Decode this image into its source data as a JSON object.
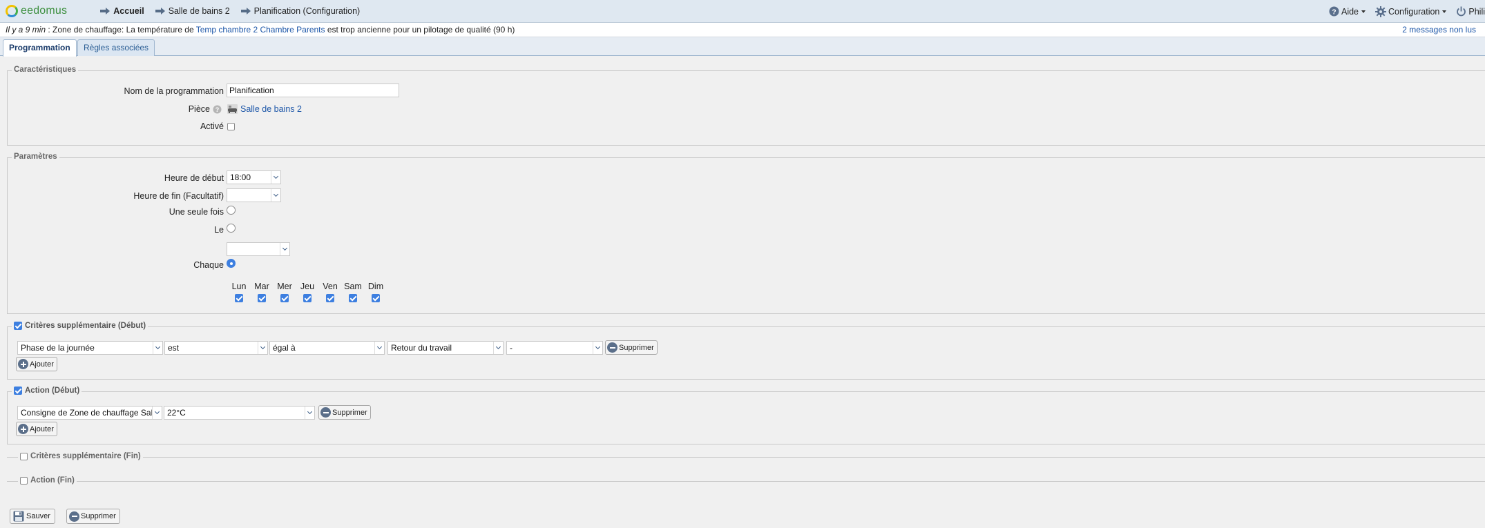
{
  "header": {
    "logo_text": "eedomus",
    "breadcrumb": [
      "Accueil",
      "Salle de bains 2",
      "Planification (Configuration)"
    ],
    "help_label": "Aide",
    "config_label": "Configuration",
    "user_label": "Phili"
  },
  "notification": {
    "time": "Il y a 9 min",
    "prefix": " : Zone de chauffage: La température de ",
    "link": "Temp chambre 2 Chambre Parents",
    "suffix": " est trop ancienne pour un pilotage de qualité (90 h)",
    "messages": "2 messages non lus"
  },
  "tabs": [
    "Programmation",
    "Règles associées"
  ],
  "caracteristiques": {
    "legend": "Caractéristiques",
    "name_label": "Nom de la programmation",
    "name_value": "Planification",
    "room_label": "Pièce",
    "room_value": "Salle de bains 2",
    "active_label": "Activé"
  },
  "parametres": {
    "legend": "Paramètres",
    "start_label": "Heure de début",
    "start_value": "18:00",
    "end_label": "Heure de fin (Facultatif)",
    "end_value": "",
    "once_label": "Une seule fois",
    "on_label": "Le",
    "each_label": "Chaque",
    "days": [
      "Lun",
      "Mar",
      "Mer",
      "Jeu",
      "Ven",
      "Sam",
      "Dim"
    ]
  },
  "criteres_debut": {
    "legend": "Critères supplémentaire (Début)",
    "fields": [
      "Phase de la journée",
      "est",
      "égal à",
      "Retour du travail",
      "-"
    ],
    "delete_label": "Supprimer",
    "add_label": "Ajouter"
  },
  "action_debut": {
    "legend": "Action (Début)",
    "fields": [
      "Consigne de Zone de chauffage Sal",
      "22°C"
    ],
    "delete_label": "Supprimer",
    "add_label": "Ajouter"
  },
  "criteres_fin": {
    "legend": "Critères supplémentaire (Fin)"
  },
  "action_fin": {
    "legend": "Action (Fin)"
  },
  "footer": {
    "save_label": "Sauver",
    "delete_label": "Supprimer"
  }
}
